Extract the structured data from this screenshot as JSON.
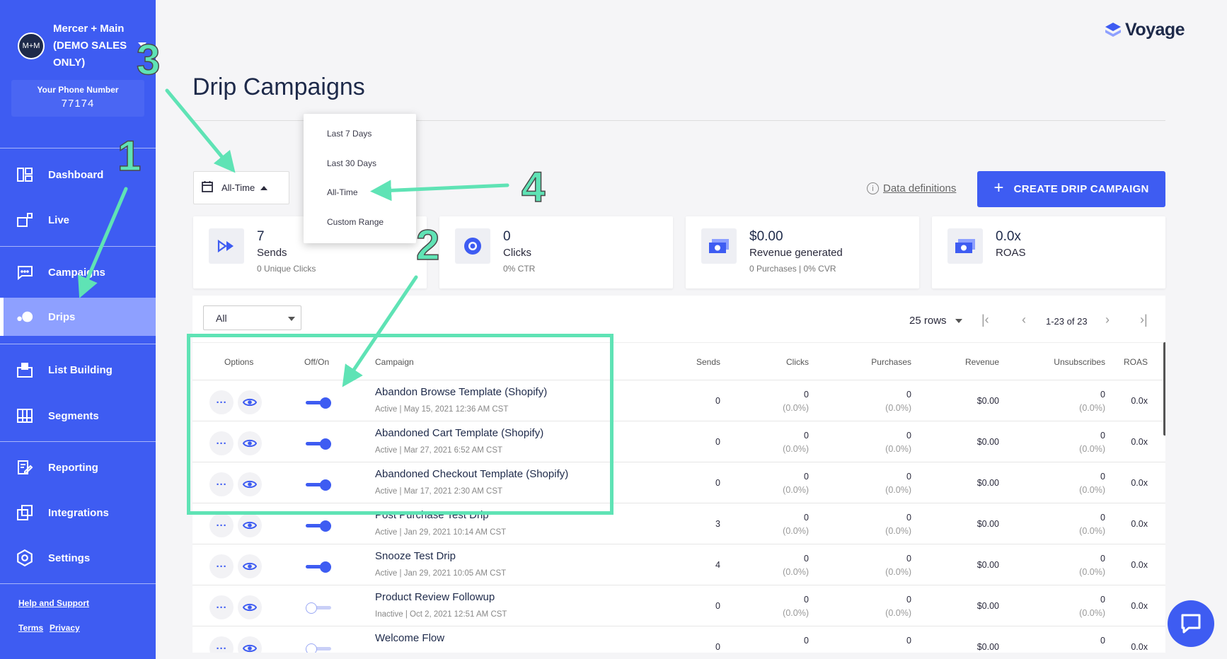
{
  "sidebar": {
    "avatar_initials": "M+M",
    "account_name": "Mercer + Main (DEMO SALES ONLY)",
    "phone_label": "Your Phone Number",
    "phone_number": "77174",
    "items": [
      {
        "label": "Dashboard",
        "icon": "dashboard-icon"
      },
      {
        "label": "Live",
        "icon": "live-icon"
      },
      {
        "label": "Campaigns",
        "icon": "campaigns-icon"
      },
      {
        "label": "Drips",
        "icon": "drips-icon",
        "active": true
      },
      {
        "label": "List Building",
        "icon": "list-building-icon"
      },
      {
        "label": "Segments",
        "icon": "segments-icon"
      },
      {
        "label": "Reporting",
        "icon": "reporting-icon"
      },
      {
        "label": "Integrations",
        "icon": "integrations-icon"
      },
      {
        "label": "Settings",
        "icon": "settings-icon"
      }
    ],
    "help_link": "Help and Support",
    "terms_link": "Terms",
    "privacy_link": "Privacy"
  },
  "brand": {
    "logo_text": "Voyage",
    "accent": "#3e5cf2",
    "annotation_color": "#5fe3b5"
  },
  "page": {
    "title": "Drip Campaigns"
  },
  "date_filter": {
    "selected": "All-Time",
    "options": [
      "Last 7 Days",
      "Last 30 Days",
      "All-Time",
      "Custom Range"
    ]
  },
  "toolbar": {
    "data_definitions": "Data definitions",
    "create_button": "CREATE DRIP CAMPAIGN"
  },
  "stats": [
    {
      "value": "7",
      "label": "Sends",
      "sub": "0 Unique Clicks",
      "icon": "fast-forward-icon"
    },
    {
      "value": "0",
      "label": "Clicks",
      "sub": "0% CTR",
      "icon": "target-icon"
    },
    {
      "value": "$0.00",
      "label": "Revenue generated",
      "sub": "0 Purchases | 0% CVR",
      "icon": "money-icon"
    },
    {
      "value": "0.0x",
      "label": "ROAS",
      "sub": "",
      "icon": "money-icon"
    }
  ],
  "table": {
    "filter_value": "All",
    "rows_per_page": "25 rows",
    "range": "1-23 of 23",
    "columns": [
      "Options",
      "Off/On",
      "Campaign",
      "Sends",
      "Clicks",
      "Purchases",
      "Revenue",
      "Unsubscribes",
      "ROAS"
    ],
    "rows": [
      {
        "name": "Abandon Browse Template (Shopify)",
        "meta": "Active | May 15, 2021 12:36 AM CST",
        "on": true,
        "sends": "0",
        "clicks": "0",
        "clicks_pct": "(0.0%)",
        "purchases": "0",
        "purchases_pct": "(0.0%)",
        "revenue": "$0.00",
        "unsubs": "0",
        "unsubs_pct": "(0.0%)",
        "roas": "0.0x"
      },
      {
        "name": "Abandoned Cart Template (Shopify)",
        "meta": "Active | Mar 27, 2021 6:52 AM CST",
        "on": true,
        "sends": "0",
        "clicks": "0",
        "clicks_pct": "(0.0%)",
        "purchases": "0",
        "purchases_pct": "(0.0%)",
        "revenue": "$0.00",
        "unsubs": "0",
        "unsubs_pct": "(0.0%)",
        "roas": "0.0x"
      },
      {
        "name": "Abandoned Checkout Template (Shopify)",
        "meta": "Active | Mar 17, 2021 2:30 AM CST",
        "on": true,
        "sends": "0",
        "clicks": "0",
        "clicks_pct": "(0.0%)",
        "purchases": "0",
        "purchases_pct": "(0.0%)",
        "revenue": "$0.00",
        "unsubs": "0",
        "unsubs_pct": "(0.0%)",
        "roas": "0.0x"
      },
      {
        "name": "Post Purchase Test Drip",
        "meta": "Active | Jan 29, 2021 10:14 AM CST",
        "on": true,
        "sends": "3",
        "clicks": "0",
        "clicks_pct": "(0.0%)",
        "purchases": "0",
        "purchases_pct": "(0.0%)",
        "revenue": "$0.00",
        "unsubs": "0",
        "unsubs_pct": "(0.0%)",
        "roas": "0.0x"
      },
      {
        "name": "Snooze Test Drip",
        "meta": "Active | Jan 29, 2021 10:05 AM CST",
        "on": true,
        "sends": "4",
        "clicks": "0",
        "clicks_pct": "(0.0%)",
        "purchases": "0",
        "purchases_pct": "(0.0%)",
        "revenue": "$0.00",
        "unsubs": "0",
        "unsubs_pct": "(0.0%)",
        "roas": "0.0x"
      },
      {
        "name": "Product Review Followup",
        "meta": "Inactive | Oct 2, 2021 12:51 AM CST",
        "on": false,
        "sends": "0",
        "clicks": "0",
        "clicks_pct": "(0.0%)",
        "purchases": "0",
        "purchases_pct": "(0.0%)",
        "revenue": "$0.00",
        "unsubs": "0",
        "unsubs_pct": "(0.0%)",
        "roas": "0.0x"
      },
      {
        "name": "Welcome Flow",
        "meta": "",
        "on": false,
        "sends": "0",
        "clicks": "0",
        "clicks_pct": "",
        "purchases": "0",
        "purchases_pct": "",
        "revenue": "$0.00",
        "unsubs": "0",
        "unsubs_pct": "",
        "roas": "0.0x"
      }
    ]
  },
  "annotations": [
    "1",
    "2",
    "3",
    "4"
  ]
}
